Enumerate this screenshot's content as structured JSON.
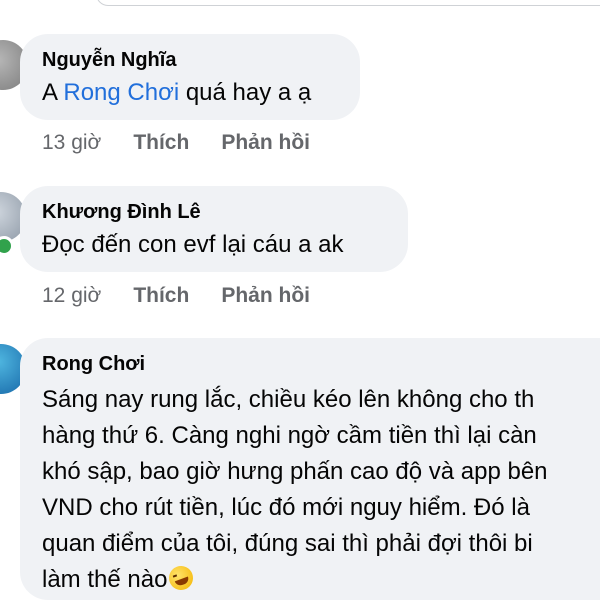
{
  "comments": [
    {
      "author": "Nguyễn Nghĩa",
      "text_prefix": "A ",
      "mention": "Rong Chơi",
      "text_suffix": " quá hay a ạ",
      "time": "13 giờ",
      "like_label": "Thích",
      "reply_label": "Phản hồi"
    },
    {
      "author": "Khương Đình Lê",
      "text": "Đọc đến con evf lại cáu a ak",
      "time": "12 giờ",
      "like_label": "Thích",
      "reply_label": "Phản hồi"
    },
    {
      "author": "Rong Chơi",
      "lines": [
        "Sáng nay rung lắc, chiều kéo lên không cho th",
        "hàng thứ 6. Càng nghi ngờ cầm tiền thì lại càn",
        "khó sập, bao giờ hưng phấn cao độ và app bên",
        "VND cho rút tiền, lúc đó mới nguy hiểm. Đó là",
        "quan điểm của tôi, đúng sai thì phải đợi thôi bi",
        "làm thế nào"
      ],
      "emoji": "rolling-on-floor-laughing-emoji"
    }
  ]
}
